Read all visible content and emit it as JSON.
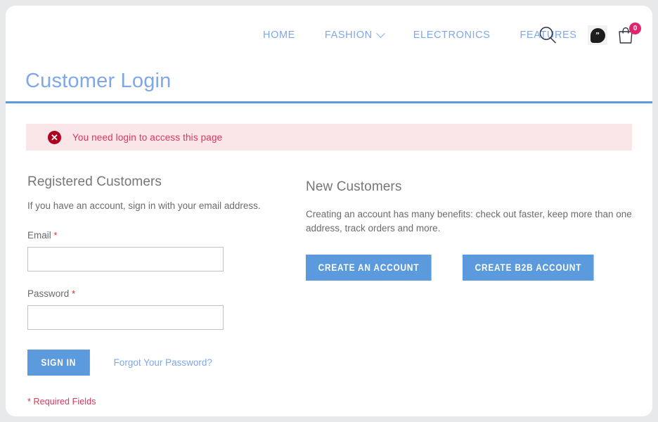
{
  "header": {
    "nav": [
      {
        "label": "HOME",
        "has_dropdown": false
      },
      {
        "label": "FASHION",
        "has_dropdown": true
      },
      {
        "label": "ELECTRONICS",
        "has_dropdown": false
      },
      {
        "label": "FEATURES",
        "has_dropdown": false
      }
    ],
    "icons": {
      "search": "search-icon",
      "chat": "chat-bubble-icon",
      "chat_glyph": "”",
      "bag": "shopping-bag-icon",
      "bag_count": "0"
    }
  },
  "page": {
    "title": "Customer Login"
  },
  "alert": {
    "icon": "✕",
    "message": "You need login to access this page"
  },
  "registered": {
    "heading": "Registered Customers",
    "lead": "If you have an account, sign in with your email address.",
    "email_label": "Email",
    "email_required": "*",
    "email_value": "",
    "password_label": "Password",
    "password_required": "*",
    "password_value": "",
    "signin_label": "SIGN IN",
    "forgot_label": "Forgot Your Password?",
    "required_note": "* Required Fields"
  },
  "new_customers": {
    "heading": "New Customers",
    "lead": "Creating an account has many benefits: check out faster, keep more than one address, track orders and more.",
    "create_account_label": "CREATE AN ACCOUNT",
    "create_b2b_label": "CREATE B2B ACCOUNT"
  },
  "colors": {
    "accent_blue": "#5b9bdd",
    "nav_blue": "#7fa8e8",
    "alert_bg": "#fae5e8",
    "alert_text": "#d9365b",
    "alert_icon_bg": "#b00020",
    "badge_pink": "#e0246e",
    "page_bg": "#e8e9eb"
  }
}
